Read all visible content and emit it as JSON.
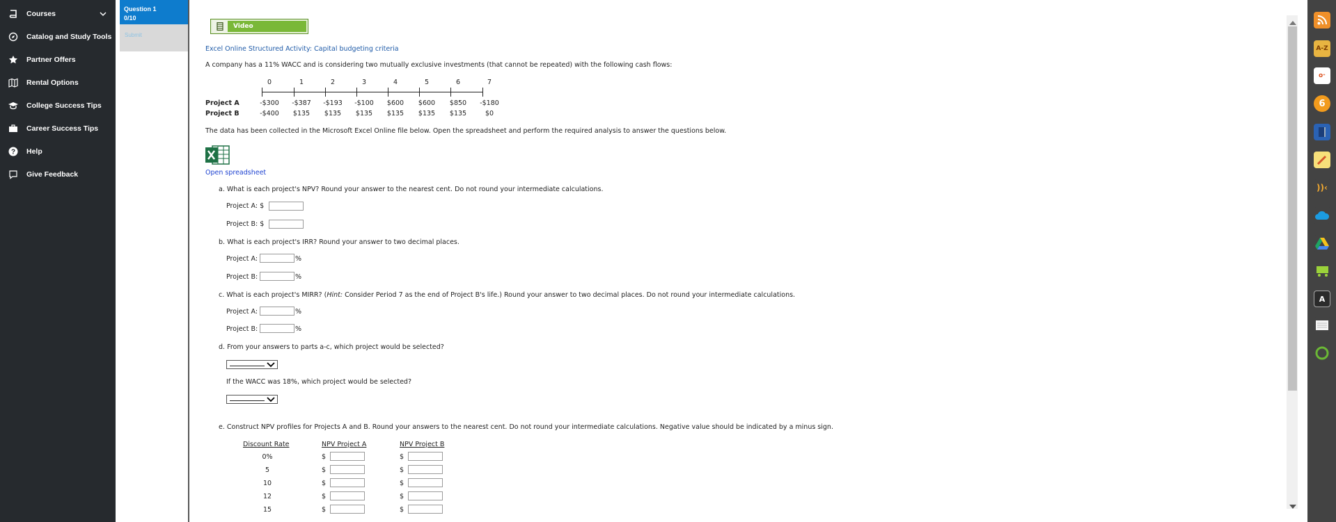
{
  "nav": {
    "items": [
      {
        "label": "Courses",
        "icon": "book-icon"
      },
      {
        "label": "Catalog and Study Tools",
        "icon": "compass-icon"
      },
      {
        "label": "Partner Offers",
        "icon": "star-icon"
      },
      {
        "label": "Rental Options",
        "icon": "map-icon"
      },
      {
        "label": "College Success Tips",
        "icon": "graduation-cap-icon"
      },
      {
        "label": "Career Success Tips",
        "icon": "briefcase-icon"
      },
      {
        "label": "Help",
        "icon": "question-icon"
      },
      {
        "label": "Give Feedback",
        "icon": "feedback-icon"
      }
    ]
  },
  "question": {
    "label": "Question 1",
    "score": "0/10",
    "submit": "Submit"
  },
  "video_label": "Video",
  "activity_title": "Excel Online Structured Activity: Capital budgeting criteria",
  "intro": "A company has a 11% WACC and is considering two mutually exclusive investments (that cannot be repeated) with the following cash flows:",
  "timeline": {
    "periods": [
      "0",
      "1",
      "2",
      "3",
      "4",
      "5",
      "6",
      "7"
    ],
    "projects": [
      {
        "name": "Project A",
        "flows": [
          "-$300",
          "-$387",
          "-$193",
          "-$100",
          "$600",
          "$600",
          "$850",
          "-$180"
        ]
      },
      {
        "name": "Project B",
        "flows": [
          "-$400",
          "$135",
          "$135",
          "$135",
          "$135",
          "$135",
          "$135",
          "$0"
        ]
      }
    ]
  },
  "data_note": "The data has been collected in the Microsoft Excel Online file below. Open the spreadsheet and perform the required analysis to answer the questions below.",
  "open_spreadsheet": "Open spreadsheet",
  "qa": {
    "a": "a. What is each project's NPV? Round your answer to the nearest cent. Do not round your intermediate calculations.",
    "b": "b. What is each project's IRR? Round your answer to two decimal places.",
    "c_pre": "c. What is each project's MIRR? (",
    "c_hint": "Hint:",
    "c_post": " Consider Period 7 as the end of Project B's life.) Round your answer to two decimal places. Do not round your intermediate calculations.",
    "d": "d. From your answers to parts a-c, which project would be selected?",
    "d2": "If the WACC was 18%, which project would be selected?",
    "e": "e. Construct NPV profiles for Projects A and B. Round your answers to the nearest cent. Do not round your intermediate calculations. Negative value should be indicated by a minus sign."
  },
  "labels": {
    "project_a_dollar": "Project A: $",
    "project_b_dollar": "Project B: $",
    "project_a": "Project A:",
    "project_b": "Project B:",
    "pct": "%",
    "dollar": "$"
  },
  "npv_table": {
    "headers": [
      "Discount Rate",
      "NPV Project A",
      "NPV Project B"
    ],
    "rates": [
      "0%",
      "5",
      "10",
      "12",
      "15"
    ]
  },
  "extensions": [
    "rss-icon",
    "a-z-icon",
    "office-icon",
    "six-icon",
    "book-icon",
    "notepad-icon",
    "signal-icon",
    "cloud-icon",
    "drive-icon",
    "cart-icon",
    "acrobat-icon",
    "paper-icon",
    "circle-icon"
  ],
  "colors": {
    "nav_bg": "#262a2e",
    "accent": "#0e7ccd",
    "video_green": "#7ab838",
    "link": "#1f5ba8"
  }
}
